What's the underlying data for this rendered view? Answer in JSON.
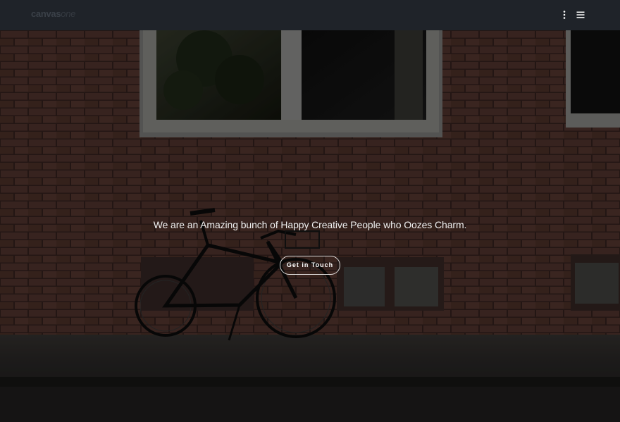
{
  "header": {
    "logo_main": "canvas",
    "logo_accent": "one"
  },
  "hero": {
    "headline": "We are an Amazing bunch of Happy Creative People who Oozes Charm.",
    "cta_label": "Get in Touch"
  },
  "colors": {
    "header_bg": "#1f2329",
    "brick": "#5a3b33",
    "cta_border": "#ffffff",
    "headline_text": "#f0f0f0"
  },
  "icons": [
    "kebab-menu-icon",
    "hamburger-menu-icon"
  ]
}
